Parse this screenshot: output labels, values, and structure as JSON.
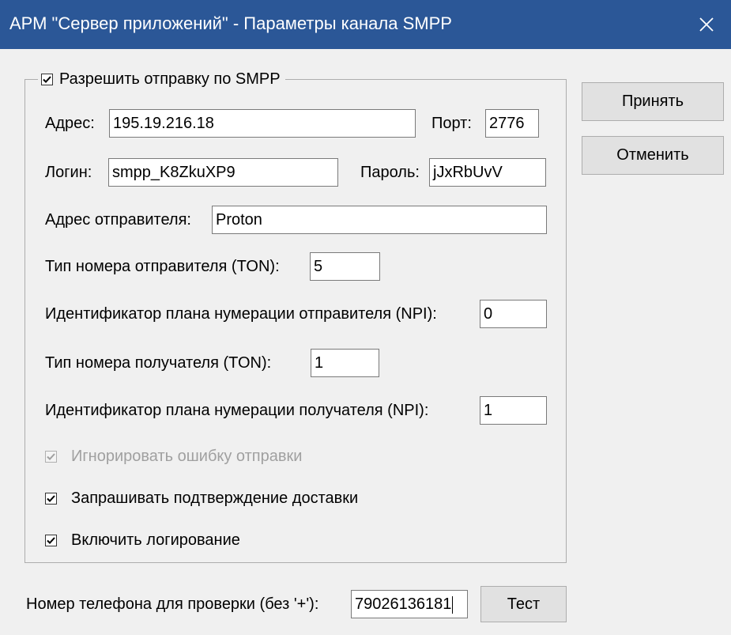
{
  "window": {
    "title": "АРМ \"Сервер приложений\" - Параметры канала SMPP"
  },
  "icons": {
    "close": "close-icon",
    "check": "checkmark-icon"
  },
  "smpp_group": {
    "enable_label": "Разрешить отправку  по SMPP",
    "enable_checked": true,
    "address_label": "Адрес:",
    "address_value": "195.19.216.18",
    "port_label": "Порт:",
    "port_value": "2776",
    "login_label": "Логин:",
    "login_value": "smpp_K8ZkuXP9",
    "password_label": "Пароль:",
    "password_value": "jJxRbUvV",
    "sender_address_label": "Адрес отправителя:",
    "sender_address_value": "Proton",
    "sender_ton_label": "Тип номера отправителя (TON):",
    "sender_ton_value": "5",
    "sender_npi_label": "Идентификатор плана нумерации отправителя (NPI):",
    "sender_npi_value": "0",
    "recipient_ton_label": "Тип номера получателя (TON):",
    "recipient_ton_value": "1",
    "recipient_npi_label": "Идентификатор плана нумерации получателя (NPI):",
    "recipient_npi_value": "1",
    "ignore_error_label": "Игнорировать ошибку отправки",
    "ignore_error_checked": true,
    "ignore_error_enabled": false,
    "delivery_confirm_label": "Запрашивать подтверждение доставки",
    "delivery_confirm_checked": true,
    "logging_label": "Включить логирование",
    "logging_checked": true
  },
  "buttons": {
    "accept_label": "Принять",
    "cancel_label": "Отменить",
    "test_label": "Тест"
  },
  "test_phone": {
    "label": "Номер телефона для проверки (без '+'):",
    "value": "79026136181"
  },
  "colors": {
    "titlebar": "#2b5797",
    "background": "#f0f0f0",
    "disabled_text": "#a0a0a0"
  }
}
